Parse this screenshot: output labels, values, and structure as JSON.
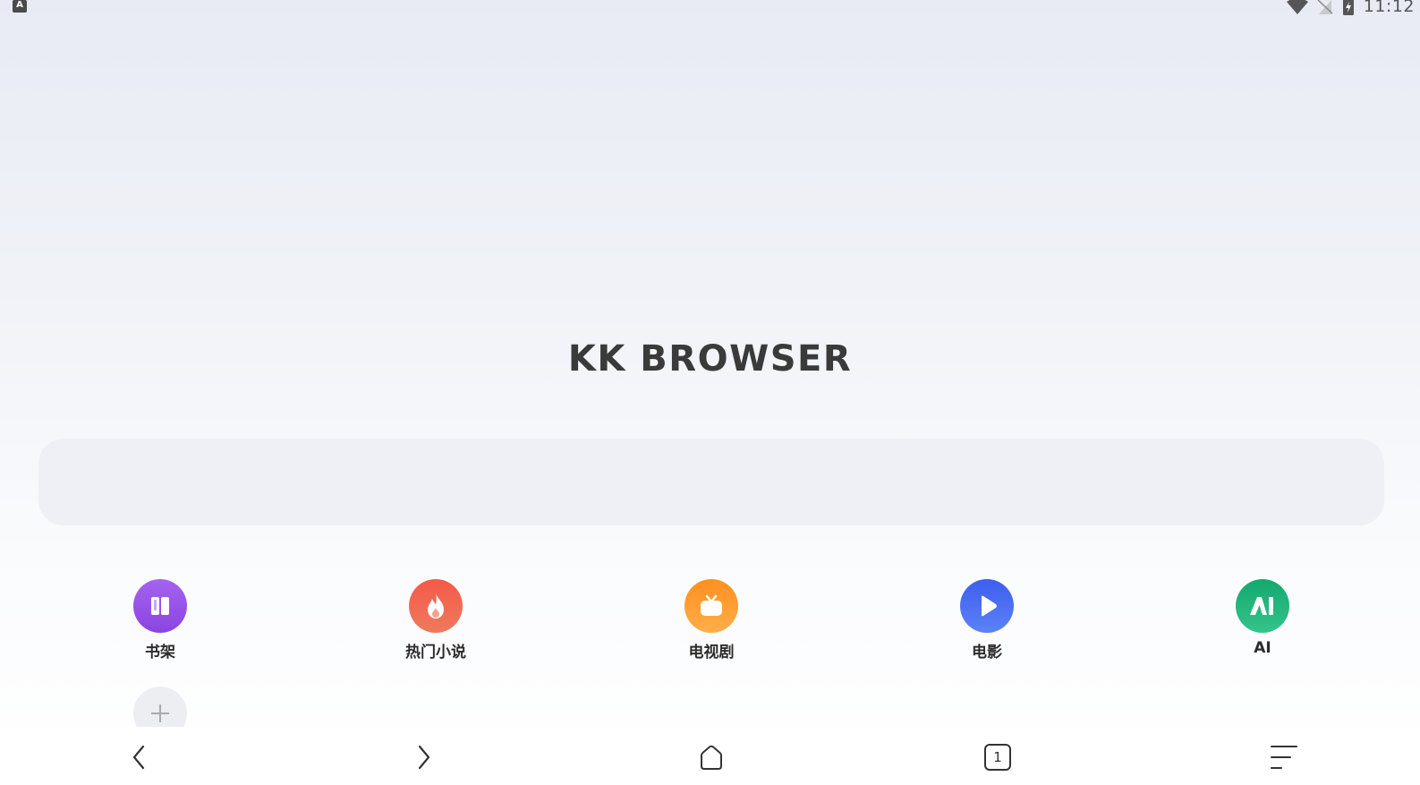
{
  "status_bar": {
    "left_icon": "keyboard-a-icon",
    "left_icon_glyph": "A",
    "time": "11:12",
    "icons": [
      "wifi-icon",
      "no-signal-icon",
      "battery-charging-icon"
    ]
  },
  "brand": {
    "logo_text": "KK BROWSER"
  },
  "search": {
    "placeholder": ""
  },
  "shortcuts": [
    {
      "label": "书架",
      "icon": "book-icon",
      "color": "#9b55e8"
    },
    {
      "label": "热门小说",
      "icon": "flame-icon",
      "color": "#f2594b"
    },
    {
      "label": "电视剧",
      "icon": "tv-icon",
      "color": "#ff9a2e"
    },
    {
      "label": "电影",
      "icon": "play-icon",
      "color": "#4a6df0"
    },
    {
      "label": "AI",
      "icon": "ai-icon",
      "color": "#22b87a"
    }
  ],
  "add_shortcut": {
    "icon": "plus-icon"
  },
  "toolbar": {
    "buttons": [
      "back-icon",
      "forward-icon",
      "home-icon",
      "tabs-icon",
      "menu-icon"
    ],
    "tab_count": "1"
  }
}
